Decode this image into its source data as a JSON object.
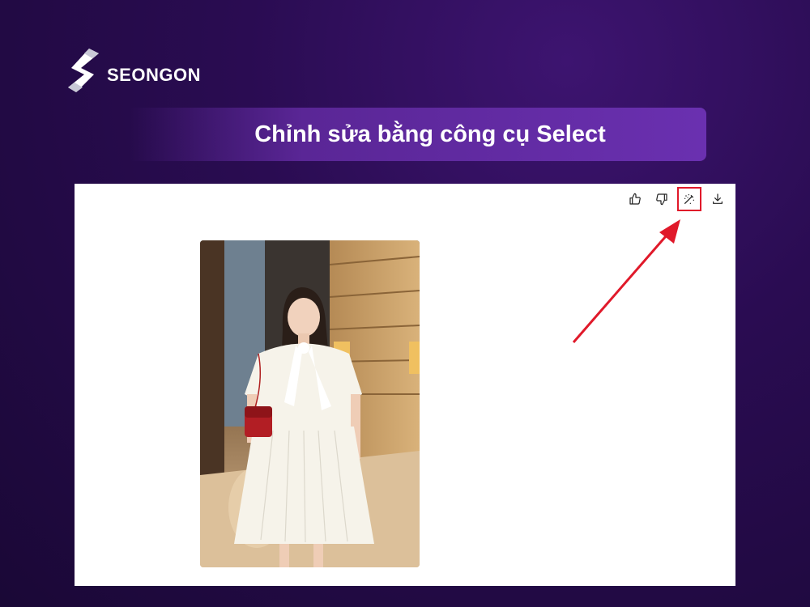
{
  "brand": {
    "name": "SEONGON"
  },
  "title": "Chỉnh sửa bằng công cụ Select",
  "toolbar": {
    "buttons": [
      {
        "icon": "thumbs-up-icon"
      },
      {
        "icon": "thumbs-down-icon"
      },
      {
        "icon": "select-edit-icon",
        "highlighted": true
      },
      {
        "icon": "download-icon"
      }
    ]
  },
  "image": {
    "subject": "woman-in-white-dress-with-red-bag"
  },
  "colors": {
    "background": "#2a0c52",
    "banner": "#6a30b0",
    "highlight": "#e0192a"
  }
}
